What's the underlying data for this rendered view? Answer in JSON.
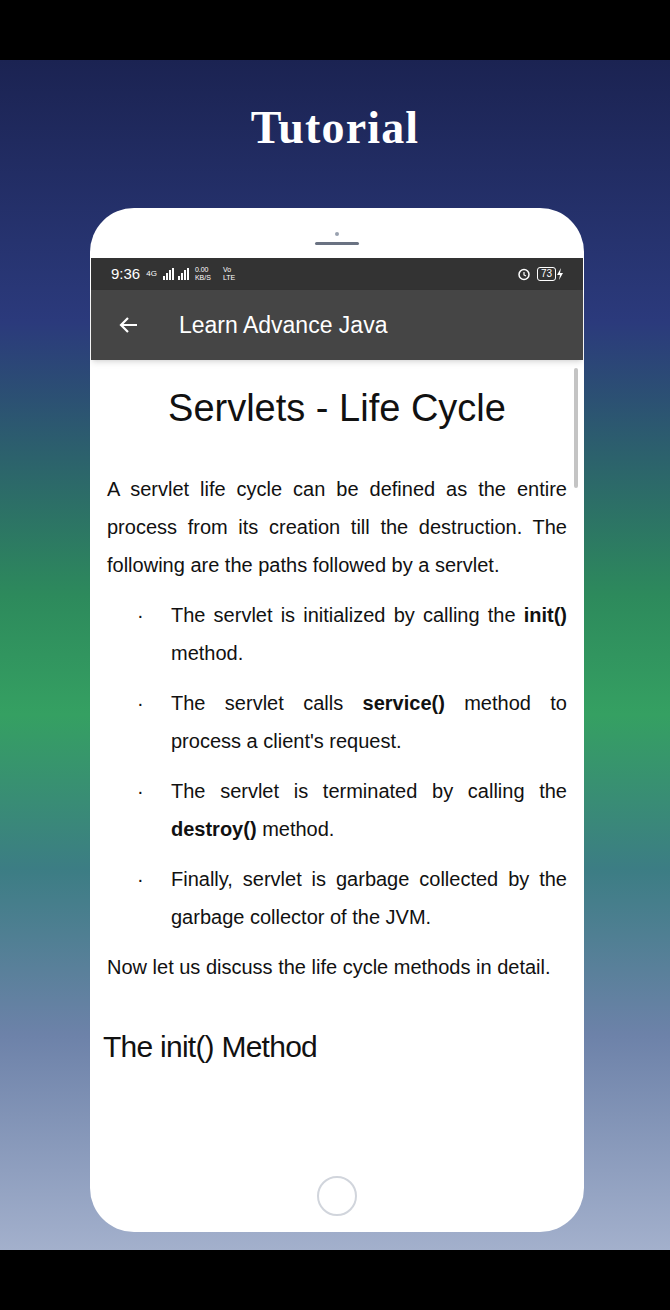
{
  "banner": {
    "title": "Tutorial"
  },
  "status_bar": {
    "time": "9:36",
    "network": "4G",
    "speed": "0.00 KB/S",
    "volte": "Vo LTE",
    "battery": "73",
    "charging": true
  },
  "app_bar": {
    "title": "Learn Advance Java"
  },
  "article": {
    "title": "Servlets - Life Cycle",
    "intro": "A servlet life cycle can be defined as the entire process from its creation till the destruction. The following are the paths followed by a servlet.",
    "bullet_mark": "·",
    "bullets": [
      {
        "parts": [
          {
            "text": "The servlet is initialized by calling the ",
            "bold": false
          },
          {
            "text": "init()",
            "bold": true
          },
          {
            "text": " method.",
            "bold": false
          }
        ]
      },
      {
        "parts": [
          {
            "text": "The servlet calls ",
            "bold": false
          },
          {
            "text": "service()",
            "bold": true
          },
          {
            "text": " method to process a client's request.",
            "bold": false
          }
        ]
      },
      {
        "parts": [
          {
            "text": "The servlet is terminated by calling the ",
            "bold": false
          },
          {
            "text": "destroy()",
            "bold": true
          },
          {
            "text": " method.",
            "bold": false
          }
        ]
      },
      {
        "parts": [
          {
            "text": "Finally, servlet is garbage collected by the garbage collector of the JVM.",
            "bold": false
          }
        ]
      }
    ],
    "outro": "Now let us discuss the life cycle methods in detail.",
    "section_title": "The init() Method"
  }
}
